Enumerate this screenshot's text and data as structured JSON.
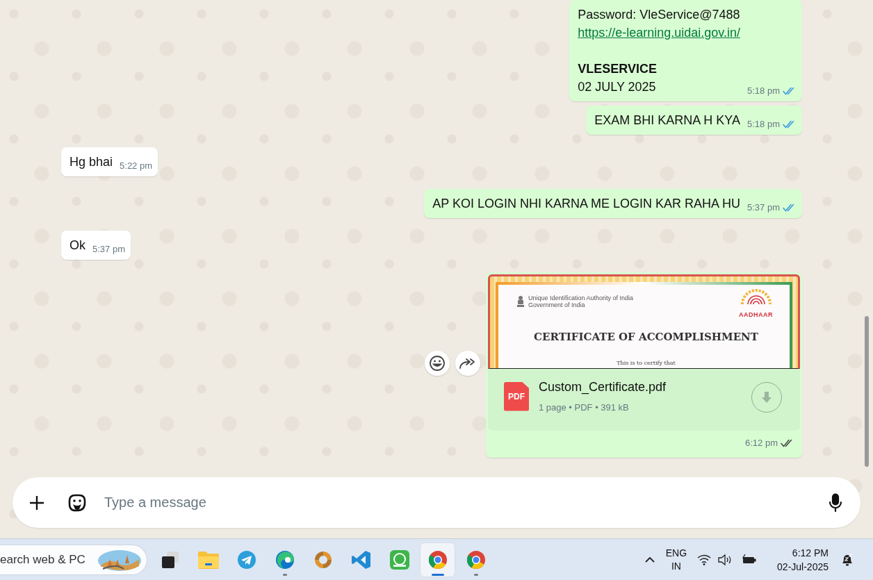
{
  "chat": {
    "messages": [
      {
        "outgoing": true,
        "kind": "text",
        "paragraphs": [
          [
            {
              "kind": "text",
              "text": "Password: VleService@7488"
            },
            {
              "kind": "link",
              "text": "https://e-learning.uidai.gov.in/"
            }
          ],
          [
            {
              "kind": "bold",
              "text": "VLESERVICE"
            },
            {
              "kind": "text",
              "text": "02 JULY 2025"
            }
          ]
        ],
        "time": "5:18 pm",
        "read": true
      },
      {
        "outgoing": true,
        "kind": "text",
        "paragraphs": [
          [
            {
              "kind": "text",
              "text": "EXAM BHI KARNA H KYA"
            }
          ]
        ],
        "time": "5:18 pm",
        "read": true
      },
      {
        "outgoing": false,
        "kind": "text",
        "paragraphs": [
          [
            {
              "kind": "text",
              "text": "Hg bhai"
            }
          ]
        ],
        "time": "5:22 pm"
      },
      {
        "outgoing": true,
        "kind": "text",
        "paragraphs": [
          [
            {
              "kind": "text",
              "text": "AP KOI LOGIN NHI KARNA ME LOGIN KAR RAHA HU"
            }
          ]
        ],
        "time": "5:37 pm",
        "read": true
      },
      {
        "outgoing": false,
        "kind": "text",
        "paragraphs": [
          [
            {
              "kind": "text",
              "text": "Ok"
            }
          ]
        ],
        "time": "5:37 pm"
      },
      {
        "outgoing": true,
        "kind": "document",
        "hovered": true,
        "preview": {
          "org": "Unique Identification Authority of India",
          "org_sub": "Government of India",
          "logo_label": "AADHAAR",
          "title": "CERTIFICATE OF ACCOMPLISHMENT",
          "line": "This is to certify that"
        },
        "file": {
          "icon_label": "PDF",
          "name": "Custom_Certificate.pdf",
          "details": "1 page • PDF • 391 kB"
        },
        "time": "6:12 pm",
        "read": false
      }
    ]
  },
  "composer": {
    "placeholder": "Type a message"
  },
  "taskbar": {
    "search": {
      "placeholder": "earch web & PC"
    },
    "apps": [
      {
        "kind": "task-view",
        "running": false,
        "selected": false
      },
      {
        "kind": "folder",
        "running": false,
        "selected": false
      },
      {
        "kind": "telegram",
        "running": false,
        "selected": false
      },
      {
        "kind": "edge",
        "running": true,
        "selected": false
      },
      {
        "kind": "sync",
        "running": false,
        "selected": false
      },
      {
        "kind": "vscode",
        "running": false,
        "selected": false
      },
      {
        "kind": "sender",
        "running": false,
        "selected": false
      },
      {
        "kind": "chrome",
        "running": true,
        "selected": true
      },
      {
        "kind": "chrome",
        "running": true,
        "selected": false
      }
    ],
    "tray": {
      "language": "ENG",
      "region": "IN",
      "time": "6:12 PM",
      "date": "02-Jul-2025"
    }
  }
}
